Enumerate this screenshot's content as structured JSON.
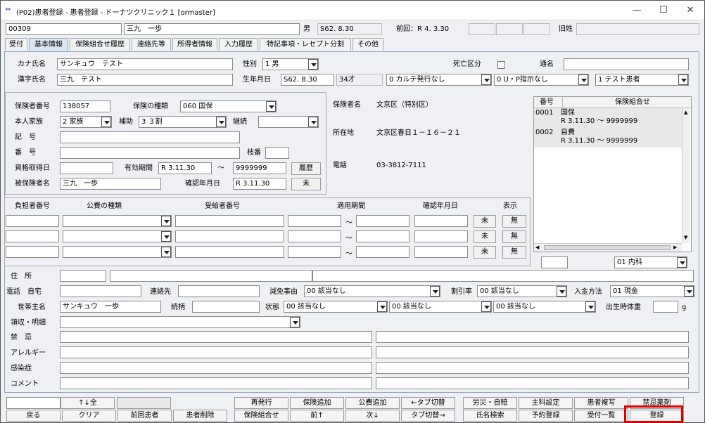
{
  "window": {
    "title": "(P02)患者登録 - 患者登録 - ドーナツクリニック１ [ormaster]",
    "minimize": "—",
    "maximize": "☐",
    "close": "✕"
  },
  "header": {
    "patient_id": "00309",
    "patient_name": "三九　一歩",
    "sex": "男",
    "birth": "S62. 8.30",
    "last_visit": "前回：R 4. 3.30",
    "old_name_label": "旧姓"
  },
  "tabs": [
    "受付",
    "基本情報",
    "保険組合せ履歴",
    "連絡先等",
    "所得者情報",
    "入力履歴",
    "特記事項・レセプト分割",
    "その他"
  ],
  "basic": {
    "kana_label": "カナ氏名",
    "kana": "サンキュウ　テスト",
    "kanji_label": "漢字氏名",
    "kanji": "三九　テスト",
    "sex_label": "性別",
    "sex": "1 男",
    "dob_label": "生年月日",
    "dob": "S62. 8.30",
    "age": "34才",
    "death_label": "死亡区分",
    "alias_label": "通名",
    "karte": "0 カルテ発行なし",
    "up": "0 U・P指示なし",
    "patient_type": "1 テスト患者"
  },
  "insurance": {
    "insurer_no_label": "保険者番号",
    "insurer_no": "138057",
    "type_label": "保険の種類",
    "type": "060 国保",
    "relation_label": "本人家族",
    "relation": "2 家族",
    "aid_label": "補助",
    "aid": "3 ３割",
    "cont_label": "継続",
    "kigo_label": "記　号",
    "bango_label": "番　号",
    "edaban_label": "枝番",
    "acq_label": "資格取得日",
    "valid_label": "有効期間",
    "valid_from": "R 3.11.30",
    "tilde": "～",
    "valid_to": "9999999",
    "history_btn": "履歴",
    "insured_label": "被保険者名",
    "insured": "三九　一歩",
    "confirm_label": "確認年月日",
    "confirm": "R 3.11.30",
    "unconfirmed_btn": "未",
    "insurer_name_label": "保険者名",
    "insurer_name": "文京区（特別区）",
    "address_label": "所在地",
    "address": "文京区春日１－１６－２１",
    "tel_label": "電話",
    "tel": "03-3812-7111"
  },
  "combo": {
    "col_no": "番号",
    "col_combo": "保険組合せ",
    "rows": [
      {
        "no": "0001",
        "name": "国保",
        "period": "R 3.11.30 ～ 9999999"
      },
      {
        "no": "0002",
        "name": "自費",
        "period": "R 3.11.30 ～ 9999999"
      }
    ],
    "dept": "01 内科"
  },
  "public": {
    "cols": [
      "負担者番号",
      "公費の種類",
      "受給者番号",
      "適用期間",
      "確認年月日",
      "表示"
    ],
    "tilde": "～",
    "mi": "未",
    "mu": "無"
  },
  "contact": {
    "address_label": "住　所",
    "tel_label": "電話　自宅",
    "contact_label": "連絡先",
    "reduction_label": "減免事由",
    "reduction": "00 該当なし",
    "discount_label": "割引率",
    "discount": "00 該当なし",
    "payment_label": "入金方法",
    "payment": "01 現金",
    "head_label": "世帯主名",
    "head": "サンキュウ　一歩",
    "relation_label": "続柄",
    "status_label": "状態",
    "status1": "00 該当なし",
    "status2": "00 該当なし",
    "status3": "00 該当なし",
    "birth_weight_label": "出生時体重",
    "unit_g": "g",
    "receipt_label": "領収・明細",
    "taboo_label": "禁　忌",
    "allergy_label": "アレルギー",
    "infection_label": "感染症",
    "comment_label": "コメント"
  },
  "footer": {
    "row1": [
      "↑↓全",
      "",
      "再発行",
      "保険追加",
      "公費追加",
      "←タブ切替",
      "労災・自賠",
      "主科設定",
      "患者複写",
      "禁忌薬剤"
    ],
    "row2": [
      "戻る",
      "クリア",
      "前回患者",
      "患者削除",
      "保険組合せ",
      "前↑",
      "次↓",
      "タブ切替→",
      "氏名検索",
      "予約登録",
      "受付一覧",
      "登録"
    ]
  }
}
